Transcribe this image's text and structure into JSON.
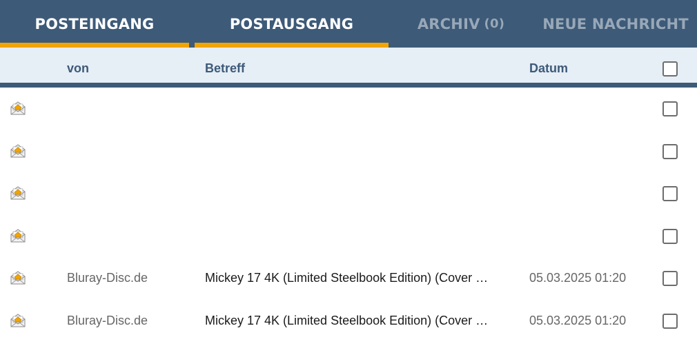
{
  "tabs": {
    "posteingang": "POSTEINGANG",
    "postausgang": "POSTAUSGANG",
    "archiv": "ARCHIV",
    "archiv_count": "(0)",
    "neu": "NEUE NACHRICHT"
  },
  "columns": {
    "von": "von",
    "betreff": "Betreff",
    "datum": "Datum"
  },
  "rows": [
    {
      "from": "",
      "subject": "",
      "date": ""
    },
    {
      "from": "",
      "subject": "",
      "date": ""
    },
    {
      "from": "",
      "subject": "",
      "date": ""
    },
    {
      "from": "",
      "subject": "",
      "date": ""
    },
    {
      "from": "Bluray-Disc.de",
      "subject": "Mickey 17 4K (Limited Steelbook Edition) (Cover …",
      "date": "05.03.2025 01:20"
    },
    {
      "from": "Bluray-Disc.de",
      "subject": "Mickey 17 4K (Limited Steelbook Edition) (Cover …",
      "date": "05.03.2025 01:20"
    }
  ],
  "icons": {
    "row_icon": "open-envelope-icon"
  },
  "colors": {
    "header_bg": "#3d5a78",
    "accent": "#f0a500",
    "column_header_bg": "#e6eef6",
    "inactive_tab": "#98a8b8"
  }
}
